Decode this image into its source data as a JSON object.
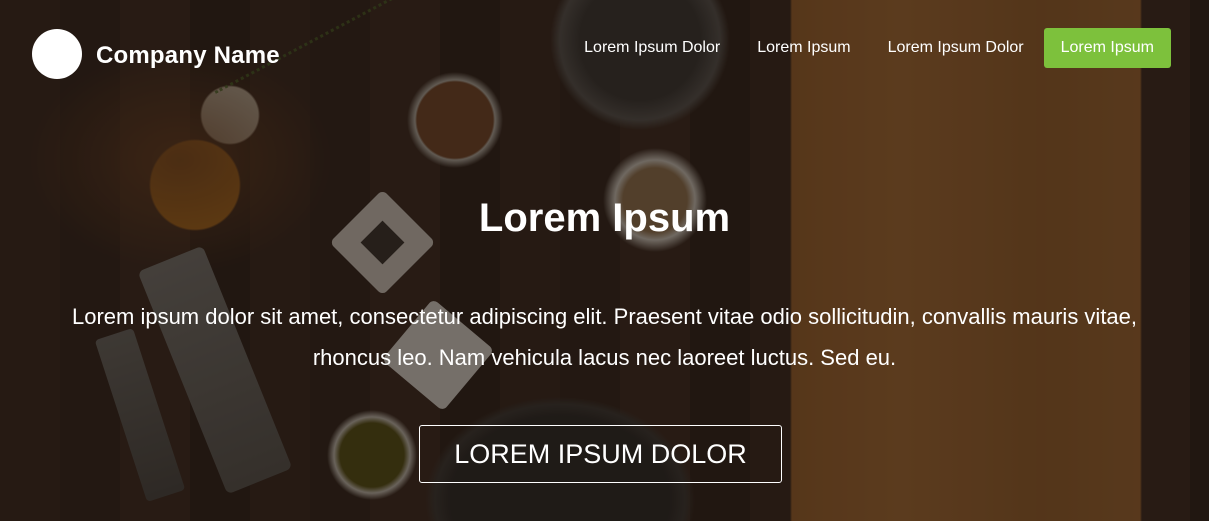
{
  "header": {
    "company_name": "Company Name",
    "nav": [
      {
        "label": "Lorem Ipsum Dolor",
        "active": false
      },
      {
        "label": "Lorem Ipsum",
        "active": false
      },
      {
        "label": "Lorem Ipsum Dolor",
        "active": false
      },
      {
        "label": "Lorem Ipsum",
        "active": true
      }
    ]
  },
  "hero": {
    "title": "Lorem Ipsum",
    "text": "Lorem ipsum dolor sit amet, consectetur adipiscing elit. Praesent vitae odio sollicitudin, convallis mauris vitae, rhoncus leo. Nam vehicula lacus nec laoreet luctus. Sed eu.",
    "cta_label": "LOREM IPSUM DOLOR"
  },
  "colors": {
    "accent": "#7dc13c",
    "overlay": "rgba(22,14,10,0.55)",
    "text": "#ffffff"
  },
  "icons": {
    "logo": "white-circle-logo"
  }
}
